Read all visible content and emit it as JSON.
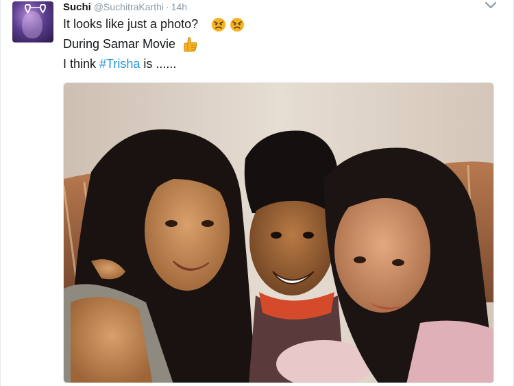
{
  "tweet": {
    "author_name": "Suchi",
    "handle": "@SuchitraKarthi",
    "separator": "·",
    "time": "14h",
    "lines": [
      {
        "text": "It looks like just a photo?",
        "emoji": [
          "angry-face-icon",
          "angry-face-icon"
        ]
      },
      {
        "text": "During Samar Movie",
        "emoji": [
          "thumbs-up-icon"
        ]
      },
      {
        "prefix": "I think ",
        "hashtag": "#Trisha",
        "suffix": " is ......"
      }
    ]
  },
  "colors": {
    "text": "#14171a",
    "muted": "#8899a6",
    "link": "#1b95e0",
    "border": "#e1e8ed"
  },
  "icons": {
    "caret": "chevron-down-icon"
  }
}
